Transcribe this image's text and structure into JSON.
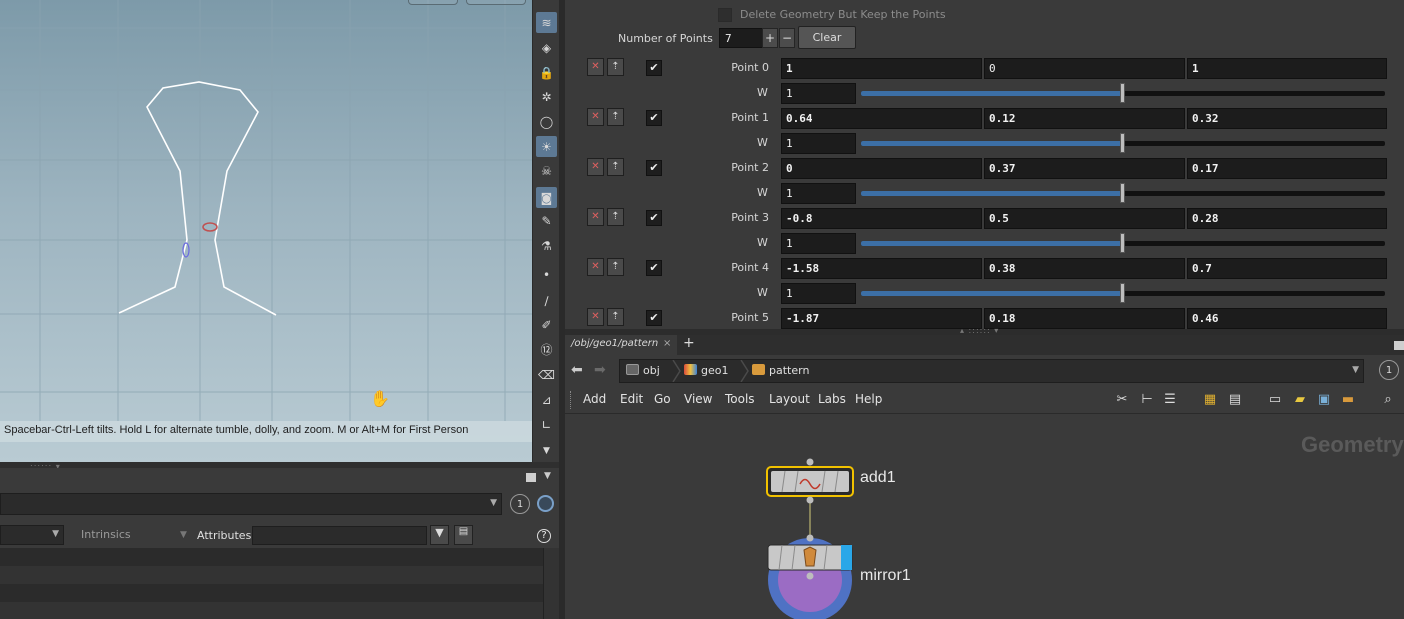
{
  "viewport": {
    "hint": "Spacebar-Ctrl-Left tilts. Hold L for alternate tumble, dolly, and zoom. M or Alt+M for First Person"
  },
  "geometry_panel": {
    "circle_number": "1",
    "filter_intrinsics": "Intrinsics",
    "attributes_label": "Attributes:",
    "attributes_value": "",
    "help": "?"
  },
  "params": {
    "delete_geometry_label": "Delete Geometry But Keep the Points",
    "number_of_points_label": "Number of Points",
    "number_of_points": "7",
    "plus": "+",
    "minus": "−",
    "clear_label": "Clear",
    "w_label": "W",
    "points": [
      {
        "label": "Point 0",
        "x": "1",
        "y": "0",
        "z": "1",
        "w": "1",
        "w_level": 0.5
      },
      {
        "label": "Point 1",
        "x": "0.64",
        "y": "0.12",
        "z": "0.32",
        "w": "1",
        "w_level": 0.5
      },
      {
        "label": "Point 2",
        "x": "0",
        "y": "0.37",
        "z": "0.17",
        "w": "1",
        "w_level": 0.5
      },
      {
        "label": "Point 3",
        "x": "-0.8",
        "y": "0.5",
        "z": "0.28",
        "w": "1",
        "w_level": 0.5
      },
      {
        "label": "Point 4",
        "x": "-1.58",
        "y": "0.38",
        "z": "0.7",
        "w": "1",
        "w_level": 0.5
      },
      {
        "label": "Point 5",
        "x": "-1.87",
        "y": "0.18",
        "z": "0.46",
        "w": "1",
        "w_level": 0.5
      }
    ]
  },
  "network": {
    "tab_label": "/obj/geo1/pattern",
    "tab_close": "×",
    "add_tab": "+",
    "breadcrumbs": [
      "obj",
      "geo1",
      "pattern"
    ],
    "circle_number": "1",
    "menu": [
      "Add",
      "Edit",
      "Go",
      "View",
      "Tools",
      "Layout",
      "Labs",
      "Help"
    ],
    "watermark": "Geometry",
    "nodes": [
      {
        "name": "add1"
      },
      {
        "name": "mirror1"
      }
    ]
  },
  "colors": {
    "selected_node_outline": "#f2c200",
    "display_flag": "#2aa7e8",
    "mirror_ring": "#4f72c4",
    "mirror_inner": "#9b6cc4",
    "slider_fill": "#3c6fa6"
  },
  "icons": [
    "drop-down-icon",
    "hand-cursor-icon",
    "filter-icon",
    "help-icon",
    "back-arrow-icon",
    "forward-arrow-icon",
    "search-icon"
  ]
}
